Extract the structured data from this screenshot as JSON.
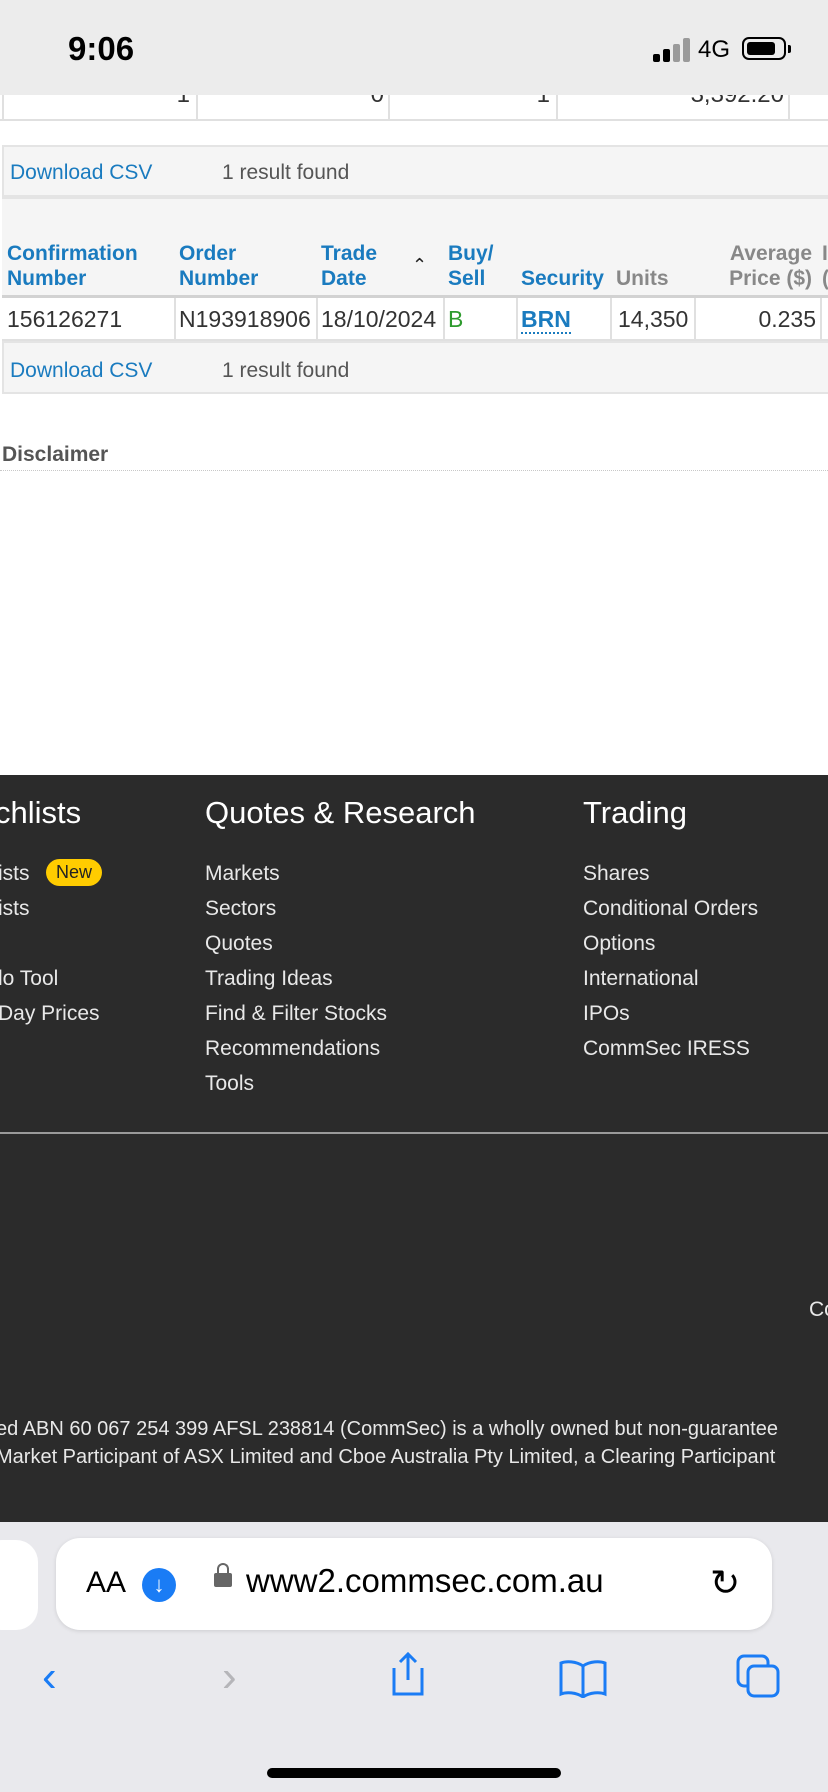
{
  "status_bar": {
    "time": "9:06",
    "network": "4G"
  },
  "previous_table_row": {
    "values": [
      "1",
      "0",
      "1",
      "3,392.20"
    ]
  },
  "result_bar": {
    "download_label": "Download CSV",
    "result_count": "1 result found"
  },
  "table": {
    "headers": {
      "confirmation": [
        "Confirmation",
        "Number"
      ],
      "order": [
        "Order",
        "Number"
      ],
      "trade_date": [
        "Trade",
        "Date"
      ],
      "buy_sell": [
        "Buy/",
        "Sell"
      ],
      "security": "Security",
      "units": "Units",
      "avg_price": [
        "Average",
        "Price ($)"
      ],
      "extra_cut": [
        "I",
        "("
      ]
    },
    "rows": [
      {
        "confirmation": "156126271",
        "order": "N193918906",
        "trade_date": "18/10/2024",
        "buy_sell": "B",
        "security": "BRN",
        "units": "14,350",
        "avg_price": "0.235"
      }
    ]
  },
  "disclaimer": {
    "title": "Disclaimer"
  },
  "footer": {
    "columns": [
      {
        "title": "chlists",
        "links": [
          "ists",
          "ists",
          "",
          "lo Tool",
          " Day Prices"
        ],
        "badge": "New"
      },
      {
        "title": "Quotes & Research",
        "links": [
          "Markets",
          "Sectors",
          "Quotes",
          "Trading Ideas",
          "Find & Filter Stocks",
          "Recommendations",
          "Tools"
        ]
      },
      {
        "title": "Trading",
        "links": [
          "Shares",
          "Conditional Orders",
          "Options",
          "International",
          "IPOs",
          "CommSec IRESS"
        ]
      }
    ],
    "cut_text": "Co",
    "legal_line_1": "ed ABN 60 067 254 399 AFSL 238814 (CommSec) is a wholly owned but non-guarantee",
    "legal_line_2": "Market Participant of ASX Limited and Cboe Australia Pty Limited, a Clearing Participant"
  },
  "browser": {
    "text_size_label": "AA",
    "url": "www2.commsec.com.au",
    "accent_color": "#1a7cf5"
  }
}
